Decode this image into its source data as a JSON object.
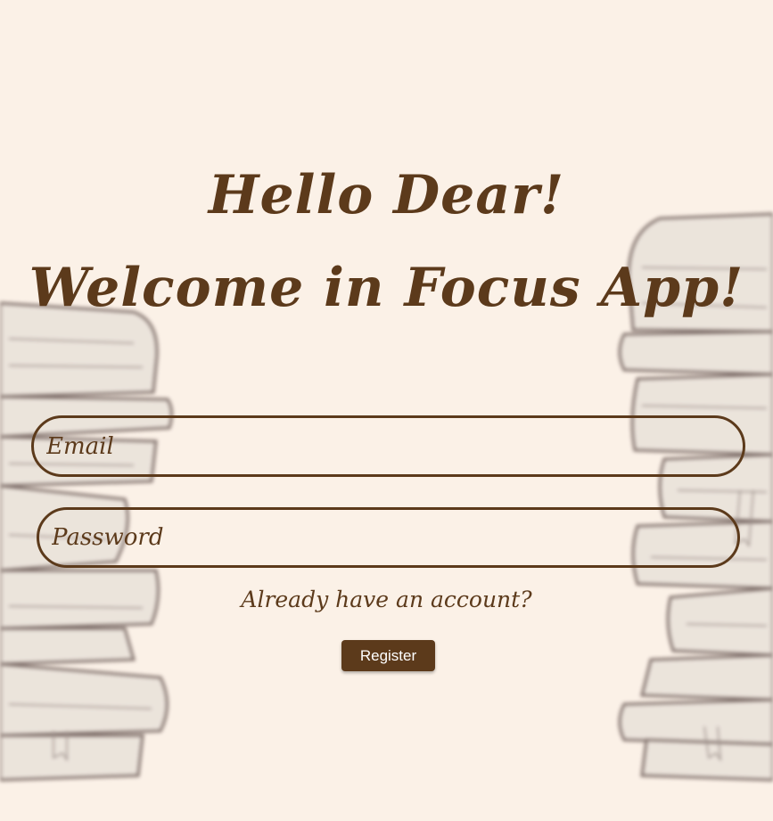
{
  "heading": {
    "line1": "Hello Dear!",
    "line2": "Welcome in Focus App!"
  },
  "form": {
    "email_placeholder": "Email",
    "password_placeholder": "Password",
    "account_link": "Already have an account?",
    "register_label": "Register"
  },
  "colors": {
    "background": "#FBF1E7",
    "accent": "#5C3A1B",
    "button_text": "#FFFFFF"
  },
  "decorations": {
    "left": "book-stack-illustration",
    "right": "book-stack-illustration"
  }
}
